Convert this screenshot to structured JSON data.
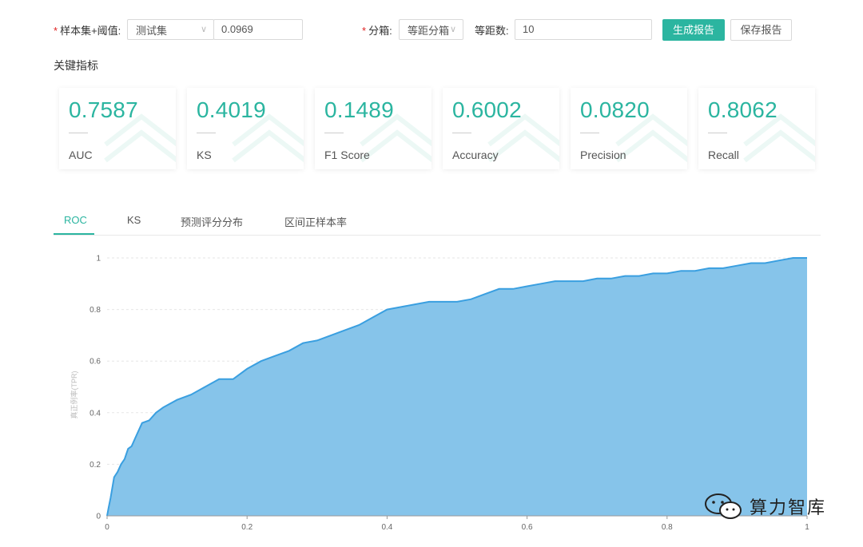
{
  "toolbar": {
    "sample_label": "样本集+阈值:",
    "sample_select": "测试集",
    "threshold_value": "0.0969",
    "binning_label": "分箱:",
    "binning_select": "等距分箱",
    "bins_label": "等距数:",
    "bins_value": "10",
    "generate_button": "生成报告",
    "save_button": "保存报告",
    "required_mark": "*",
    "caret": "∨"
  },
  "metrics": {
    "title": "关键指标",
    "items": [
      {
        "value": "0.7587",
        "label": "AUC"
      },
      {
        "value": "0.4019",
        "label": "KS"
      },
      {
        "value": "0.1489",
        "label": "F1 Score"
      },
      {
        "value": "0.6002",
        "label": "Accuracy"
      },
      {
        "value": "0.0820",
        "label": "Precision"
      },
      {
        "value": "0.8062",
        "label": "Recall"
      }
    ]
  },
  "tabs": [
    {
      "label": "ROC",
      "active": true
    },
    {
      "label": "KS",
      "active": false
    },
    {
      "label": "预测评分分布",
      "active": false
    },
    {
      "label": "区间正样本率",
      "active": false
    }
  ],
  "colors": {
    "accent": "#2bb5a0",
    "roc_fill": "#86c4ea",
    "roc_line": "#3a9fe0"
  },
  "watermark": {
    "text": "算力智库",
    "icon": "wechat-icon"
  },
  "chart_data": {
    "type": "area",
    "ylabel": "真正例率(TPR)",
    "xlabel": "",
    "xlim": [
      0,
      1
    ],
    "ylim": [
      0,
      1
    ],
    "x_ticks": [
      "0",
      "0.2",
      "0.4",
      "0.6",
      "0.8",
      "1"
    ],
    "y_ticks": [
      "0",
      "0.2",
      "0.4",
      "0.6",
      "0.8",
      "1"
    ],
    "grid": "horizontal dashed",
    "series": [
      {
        "x": [
          0,
          0.002,
          0.005,
          0.01,
          0.015,
          0.02,
          0.025,
          0.03,
          0.035,
          0.04,
          0.05,
          0.06,
          0.07,
          0.08,
          0.1,
          0.12,
          0.14,
          0.16,
          0.18,
          0.2,
          0.22,
          0.24,
          0.26,
          0.28,
          0.3,
          0.32,
          0.34,
          0.36,
          0.38,
          0.4,
          0.42,
          0.44,
          0.46,
          0.48,
          0.5,
          0.52,
          0.54,
          0.56,
          0.58,
          0.6,
          0.62,
          0.64,
          0.66,
          0.68,
          0.7,
          0.72,
          0.74,
          0.76,
          0.78,
          0.8,
          0.82,
          0.84,
          0.86,
          0.88,
          0.9,
          0.92,
          0.94,
          0.96,
          0.98,
          1.0
        ],
        "y": [
          0,
          0.03,
          0.07,
          0.15,
          0.17,
          0.2,
          0.22,
          0.26,
          0.27,
          0.3,
          0.36,
          0.37,
          0.4,
          0.42,
          0.45,
          0.47,
          0.5,
          0.53,
          0.53,
          0.57,
          0.6,
          0.62,
          0.64,
          0.67,
          0.68,
          0.7,
          0.72,
          0.74,
          0.77,
          0.8,
          0.81,
          0.82,
          0.83,
          0.83,
          0.83,
          0.84,
          0.86,
          0.88,
          0.88,
          0.89,
          0.9,
          0.91,
          0.91,
          0.91,
          0.92,
          0.92,
          0.93,
          0.93,
          0.94,
          0.94,
          0.95,
          0.95,
          0.96,
          0.96,
          0.97,
          0.98,
          0.98,
          0.99,
          1.0,
          1.0
        ]
      }
    ]
  }
}
